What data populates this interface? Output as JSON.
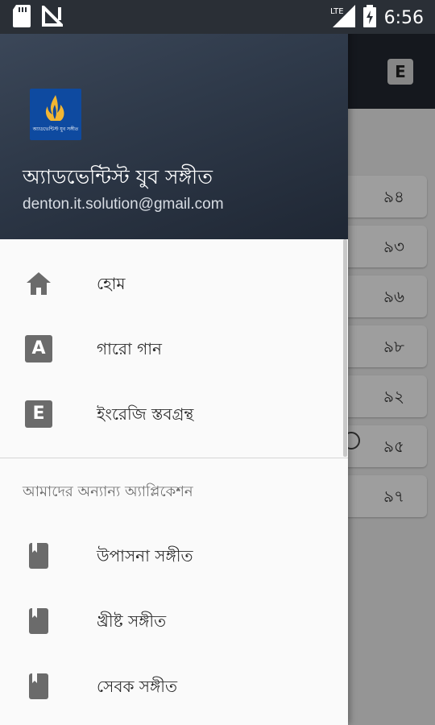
{
  "status_bar": {
    "time": "6:56",
    "network": "LTE",
    "icons": [
      "sd-card-icon",
      "no-signal-icon",
      "lte-signal-icon",
      "battery-icon"
    ]
  },
  "background": {
    "toolbar_button": "E",
    "items": [
      "৯৪",
      "৯৩",
      "৯৬",
      "৯৮",
      "৯২",
      "৯৫",
      "৯৭"
    ]
  },
  "drawer": {
    "header": {
      "title": "অ্যাডভেন্টিস্ট যুব সঙ্গীত",
      "email": "denton.it.solution@gmail.com",
      "logo_text": "অ্যাডভেন্টিস্ট যুব সঙ্গীত"
    },
    "menu": [
      {
        "label": "হোম",
        "icon": "home-icon"
      },
      {
        "label": "গারো গান",
        "icon": "letter-a-icon",
        "letter": "A"
      },
      {
        "label": "ইংরেজি স্তবগ্রন্থ",
        "icon": "letter-e-icon",
        "letter": "E"
      }
    ],
    "section_title": "আমাদের অন্যান্য অ্যাপ্লিকেশন",
    "other_apps": [
      {
        "label": "উপাসনা সঙ্গীত",
        "icon": "book-icon"
      },
      {
        "label": "খ্রীষ্ট সঙ্গীত",
        "icon": "book-icon"
      },
      {
        "label": "সেবক সঙ্গীত",
        "icon": "book-icon"
      }
    ]
  },
  "colors": {
    "status_bar": "#2a2f36",
    "header_dark": "#1f2734",
    "drawer_bg": "#fafafa",
    "icon_gray": "#6b6b6b",
    "logo_blue": "#0e4aa0"
  }
}
